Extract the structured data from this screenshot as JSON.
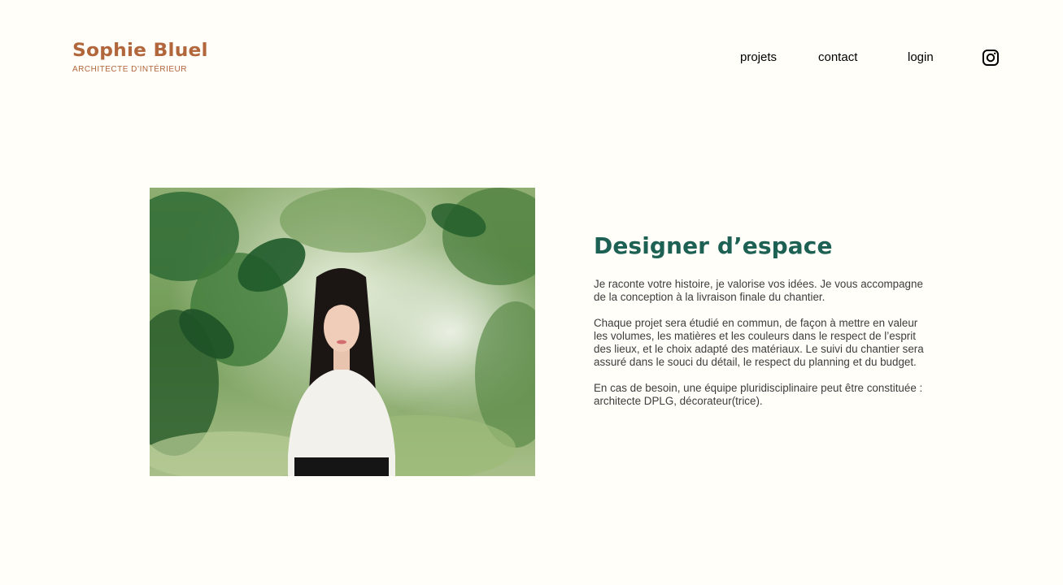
{
  "header": {
    "logo_title": "Sophie Bluel",
    "logo_subtitle": "ARCHITECTE D’INTÉRIEUR",
    "nav": {
      "projets": "projets",
      "contact": "contact",
      "login": "login",
      "instagram_icon": "instagram-icon"
    }
  },
  "intro": {
    "title": "Designer d’espace",
    "paragraphs": [
      "Je raconte votre histoire, je valorise vos idées. Je vous accompagne de la conception à la livraison finale du chantier.",
      "Chaque projet sera étudié en commun, de façon à mettre en valeur les volumes, les matières et les couleurs dans le respect de l’esprit des lieux, et le choix adapté des matériaux. Le suivi du chantier sera assuré dans le souci du détail, le respect du planning et du budget.",
      "En cas de besoin, une équipe pluridisciplinaire peut être constituée : architecte DPLG, décorateur(trice)."
    ]
  },
  "colors": {
    "brand": "#B1663C",
    "title": "#1D6154",
    "text": "#3D3D3D",
    "background": "#FFFEF8"
  }
}
